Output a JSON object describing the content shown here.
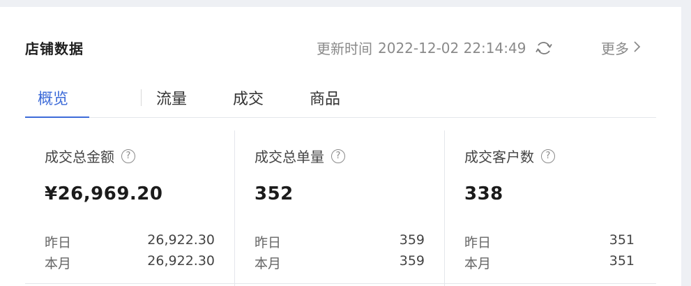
{
  "header": {
    "title": "店铺数据",
    "update_label": "更新时间",
    "update_time": "2022-12-02 22:14:49",
    "refresh_icon": "refresh-icon",
    "more_label": "更多",
    "more_icon": "chevron-right-icon"
  },
  "tabs": [
    {
      "label": "概览",
      "active": true
    },
    {
      "label": "流量",
      "active": false
    },
    {
      "label": "成交",
      "active": false
    },
    {
      "label": "商品",
      "active": false
    }
  ],
  "metrics": [
    {
      "label": "成交总金额",
      "value": "¥26,969.20",
      "rows": [
        {
          "key": "昨日",
          "value": "26,922.30"
        },
        {
          "key": "本月",
          "value": "26,922.30"
        }
      ]
    },
    {
      "label": "成交总单量",
      "value": "352",
      "rows": [
        {
          "key": "昨日",
          "value": "359"
        },
        {
          "key": "本月",
          "value": "359"
        }
      ]
    },
    {
      "label": "成交客户数",
      "value": "338",
      "rows": [
        {
          "key": "昨日",
          "value": "351"
        },
        {
          "key": "本月",
          "value": "351"
        }
      ]
    }
  ],
  "help_icon_text": "?",
  "colors": {
    "accent": "#3d6bd8",
    "background": "#eef0f4",
    "card": "#ffffff"
  }
}
